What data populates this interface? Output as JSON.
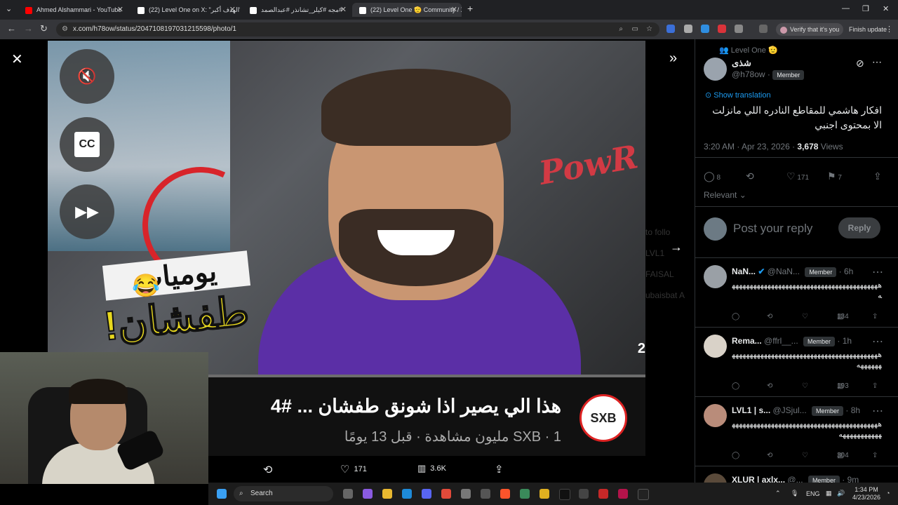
{
  "tabs": [
    {
      "label": "Ahmed Alshammari - YouTube",
      "icon": "youtube-icon",
      "color": "#ff0000"
    },
    {
      "label": "(22) Level One on X: \"الهدف أكبر\"",
      "icon": "x-icon",
      "color": "#ffffff"
    },
    {
      "label": "مجه #كيلر_تشانذر #عبدالصمد#",
      "icon": "tiktok-icon",
      "color": "#ffffff"
    },
    {
      "label": "(22) Level One 🫡 Community / X",
      "icon": "x-icon",
      "color": "#ffffff"
    }
  ],
  "address_bar": {
    "url": "x.com/h78ow/status/2047108197031215598/photo/1",
    "verify_pill": "Verify that it's you",
    "update_pill": "Finish update"
  },
  "media": {
    "thumbnail_line1": "يوميات",
    "thumbnail_line2": "طفشان!",
    "brand_sign": "PowR",
    "video_title": "هذا الي يصير اذا شونق طفشان ... #4",
    "video_meta": "SXB · 1 مليون مشاهدة · قبل 13 يومًا",
    "channel_avatar": "SXB",
    "side_number": "2",
    "ghost_text": [
      "to follo",
      "LVL1 FAISAL",
      "ubaisbat A"
    ]
  },
  "media_actions": {
    "likes": "171",
    "views": "3.6K"
  },
  "post": {
    "community": "Level One 🫡",
    "display_name": "شذى",
    "handle": "@h78ow",
    "member_badge": "Member",
    "show_translation": "Show translation",
    "text": "افكار هاشمي للمقاطع النادره اللي مانزلت الا بمحتوى اجنبي",
    "timestamp": "3:20 AM · Apr 23, 2026 · ",
    "views_count": "3,678",
    "views_label": " Views",
    "replies": "8",
    "likes": "171",
    "bookmarks": "7",
    "sort": "Relevant",
    "reply_placeholder": "Post your reply",
    "reply_button": "Reply"
  },
  "replies": [
    {
      "name": "NaN...",
      "handle": "@NaN...",
      "badge": "Member",
      "time": "· 6h",
      "text": "ههههههههههههههههههههههههههههههههههههههههههه",
      "views": "134",
      "avatar_color": "#9aa0a6"
    },
    {
      "name": "Rema...",
      "handle": "@ffrl__...",
      "badge": "Member",
      "time": "· 1h",
      "text": "ههههههههههههههههههههههههههههههههههههههههههههههههه",
      "views": "193",
      "avatar_color": "#d9d2c8"
    },
    {
      "name": "LVL1 | s...",
      "handle": "@JSjul...",
      "badge": "Member",
      "time": "· 8h",
      "text": "هههههههههههههههههههههههههههههههههههههههههههههههههههههه",
      "views": "304",
      "avatar_color": "#b98c7a"
    },
    {
      "name": "XLUR | axlx...",
      "handle": "@...",
      "badge": "Member",
      "time": "· 9m",
      "text": "",
      "views": "",
      "avatar_color": "#5a4a3a"
    }
  ],
  "taskbar": {
    "search": "Search",
    "lang": "ENG",
    "time": "1:34 PM",
    "date": "4/23/2026"
  }
}
